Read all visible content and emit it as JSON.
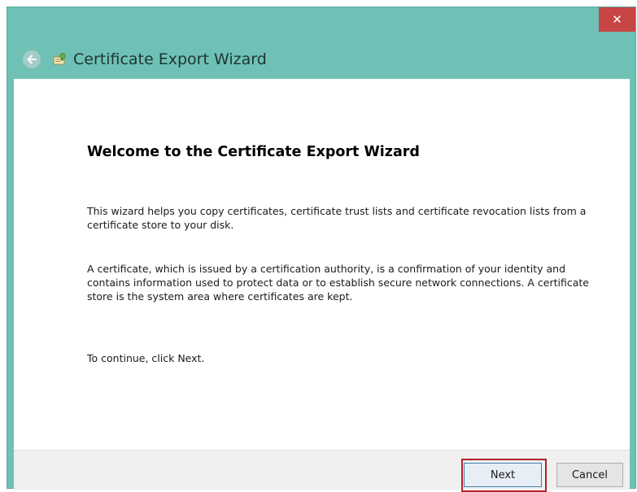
{
  "window": {
    "title": "Certificate Export Wizard",
    "close_glyph": "✕"
  },
  "header": {
    "back_icon": "back-arrow-icon",
    "wizard_icon": "certificate-icon"
  },
  "main": {
    "heading": "Welcome to the Certificate Export Wizard",
    "paragraph_1": "This wizard helps you copy certificates, certificate trust lists and certificate revocation lists from a certificate store to your disk.",
    "paragraph_2": "A certificate, which is issued by a certification authority, is a confirmation of your identity and contains information used to protect data or to establish secure network connections. A certificate store is the system area where certificates are kept.",
    "paragraph_3": "To continue, click Next."
  },
  "footer": {
    "next_label": "Next",
    "cancel_label": "Cancel"
  },
  "colors": {
    "title_bar": "#6fc1b5",
    "close_button": "#c84545",
    "highlight_border": "#b0222a",
    "footer_background": "#f0f0f0"
  }
}
